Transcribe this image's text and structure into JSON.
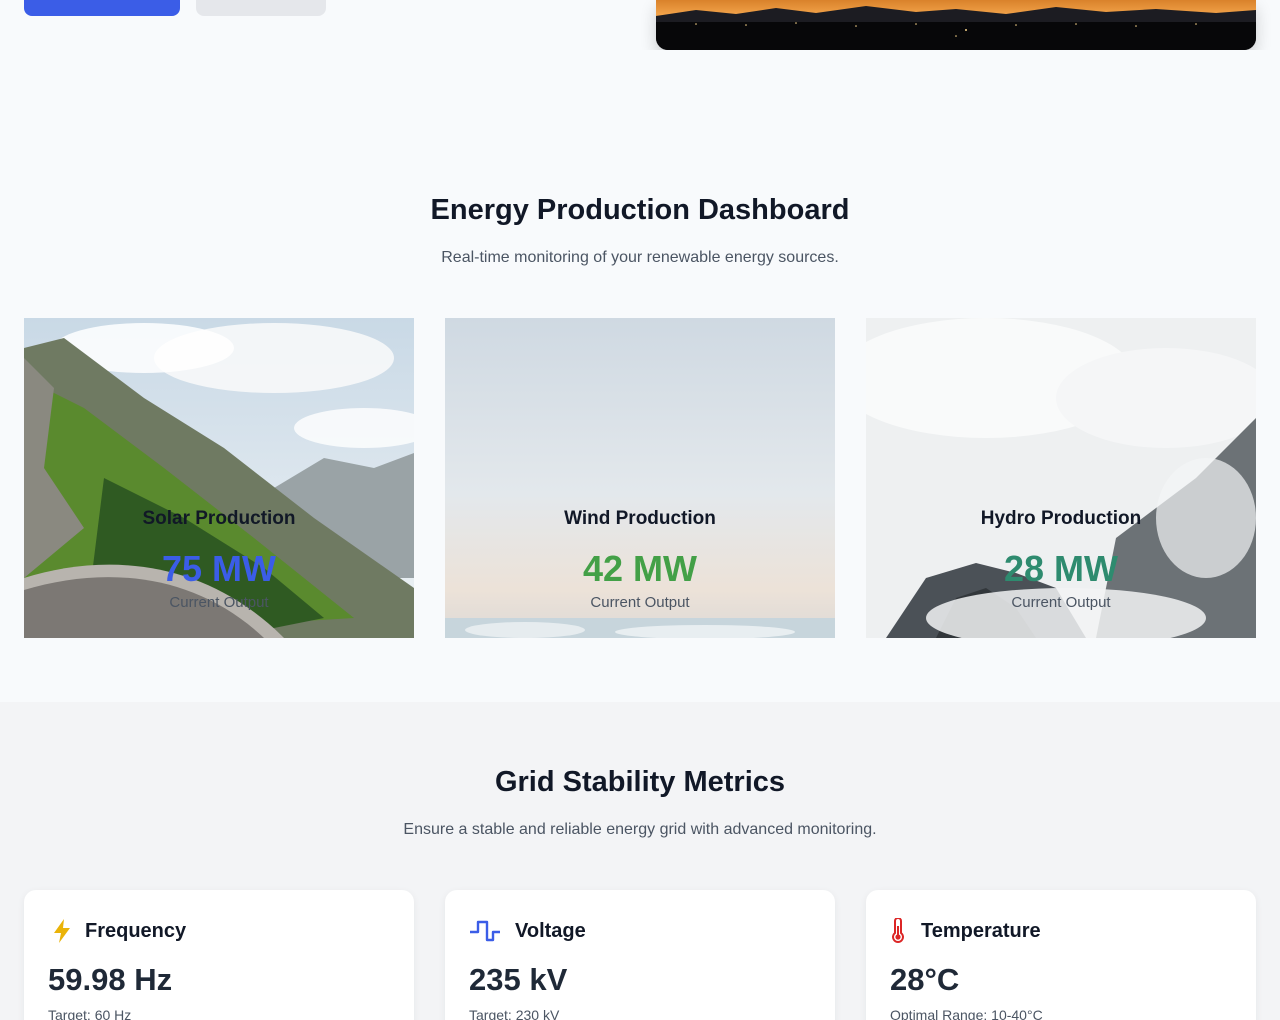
{
  "dashboard": {
    "title": "Energy Production Dashboard",
    "subtitle": "Real-time monitoring of your renewable energy sources.",
    "cards": [
      {
        "title": "Solar Production",
        "value": "75 MW",
        "label": "Current Output",
        "accent": "#3b5de7"
      },
      {
        "title": "Wind Production",
        "value": "42 MW",
        "label": "Current Output",
        "accent": "#43a047"
      },
      {
        "title": "Hydro Production",
        "value": "28 MW",
        "label": "Current Output",
        "accent": "#2e8b6f"
      }
    ]
  },
  "grid": {
    "title": "Grid Stability Metrics",
    "subtitle": "Ensure a stable and reliable energy grid with advanced monitoring.",
    "metrics": [
      {
        "name": "Frequency",
        "value": "59.98 Hz",
        "target": "Target: 60 Hz",
        "icon": "lightning-icon",
        "icon_color": "#eab308"
      },
      {
        "name": "Voltage",
        "value": "235 kV",
        "target": "Target: 230 kV",
        "icon": "waveform-icon",
        "icon_color": "#3b5de7"
      },
      {
        "name": "Temperature",
        "value": "28°C",
        "target": "Optimal Range: 10-40°C",
        "icon": "thermometer-icon",
        "icon_color": "#dc2626"
      }
    ]
  },
  "colors": {
    "primary": "#3b5de7",
    "page_bg": "#f8fafc",
    "section_bg": "#f3f4f6"
  }
}
